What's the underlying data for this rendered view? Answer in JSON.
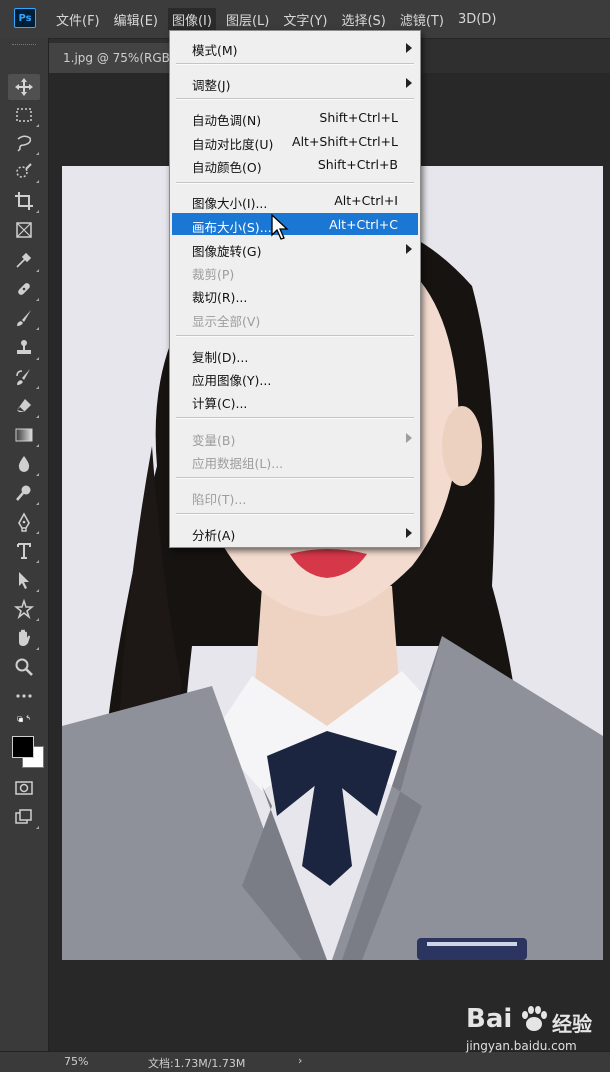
{
  "app": {
    "logo": "Ps"
  },
  "menubar": {
    "items": [
      "文件(F)",
      "编辑(E)",
      "图像(I)",
      "图层(L)",
      "文字(Y)",
      "选择(S)",
      "滤镜(T)",
      "3D(D)"
    ],
    "active": "图像(I)"
  },
  "document": {
    "tab_title": "1.jpg @ 75%(RGB"
  },
  "image_menu": {
    "items": [
      {
        "label": "模式(M)",
        "shortcut": "",
        "submenu": true,
        "enabled": true
      },
      {
        "label": "调整(J)",
        "shortcut": "",
        "submenu": true,
        "enabled": true
      },
      {
        "label": "自动色调(N)",
        "shortcut": "Shift+Ctrl+L",
        "submenu": false,
        "enabled": true
      },
      {
        "label": "自动对比度(U)",
        "shortcut": "Alt+Shift+Ctrl+L",
        "submenu": false,
        "enabled": true
      },
      {
        "label": "自动颜色(O)",
        "shortcut": "Shift+Ctrl+B",
        "submenu": false,
        "enabled": true
      },
      {
        "label": "图像大小(I)...",
        "shortcut": "Alt+Ctrl+I",
        "submenu": false,
        "enabled": true
      },
      {
        "label": "画布大小(S)...",
        "shortcut": "Alt+Ctrl+C",
        "submenu": false,
        "enabled": true,
        "highlighted": true
      },
      {
        "label": "图像旋转(G)",
        "shortcut": "",
        "submenu": true,
        "enabled": true
      },
      {
        "label": "裁剪(P)",
        "shortcut": "",
        "submenu": false,
        "enabled": false
      },
      {
        "label": "裁切(R)...",
        "shortcut": "",
        "submenu": false,
        "enabled": true
      },
      {
        "label": "显示全部(V)",
        "shortcut": "",
        "submenu": false,
        "enabled": false
      },
      {
        "label": "复制(D)...",
        "shortcut": "",
        "submenu": false,
        "enabled": true
      },
      {
        "label": "应用图像(Y)...",
        "shortcut": "",
        "submenu": false,
        "enabled": true
      },
      {
        "label": "计算(C)...",
        "shortcut": "",
        "submenu": false,
        "enabled": true
      },
      {
        "label": "变量(B)",
        "shortcut": "",
        "submenu": true,
        "enabled": false
      },
      {
        "label": "应用数据组(L)...",
        "shortcut": "",
        "submenu": false,
        "enabled": false
      },
      {
        "label": "陷印(T)...",
        "shortcut": "",
        "submenu": false,
        "enabled": false
      },
      {
        "label": "分析(A)",
        "shortcut": "",
        "submenu": true,
        "enabled": true
      }
    ]
  },
  "toolbar": {
    "tools": [
      "move-tool",
      "marquee-tool",
      "lasso-tool",
      "quick-selection-tool",
      "crop-tool",
      "frame-tool",
      "eyedropper-tool",
      "healing-brush-tool",
      "brush-tool",
      "clone-stamp-tool",
      "history-brush-tool",
      "eraser-tool",
      "gradient-tool",
      "blur-tool",
      "dodge-tool",
      "pen-tool",
      "type-tool",
      "path-selection-tool",
      "shape-tool",
      "hand-tool",
      "zoom-tool",
      "more-tools",
      "swap-colors",
      "color-swatches",
      "quick-mask",
      "screen-mode"
    ]
  },
  "colors": {
    "foreground": "#000000",
    "background": "#ffffff",
    "highlight": "#1b77d4"
  },
  "status": {
    "zoom": "75%",
    "doc_info": "文档:1.73M/1.73M",
    "arrow": "›"
  },
  "watermark": {
    "logo": "Bai",
    "logo_cn": "经验",
    "url": "jingyan.baidu.com"
  }
}
